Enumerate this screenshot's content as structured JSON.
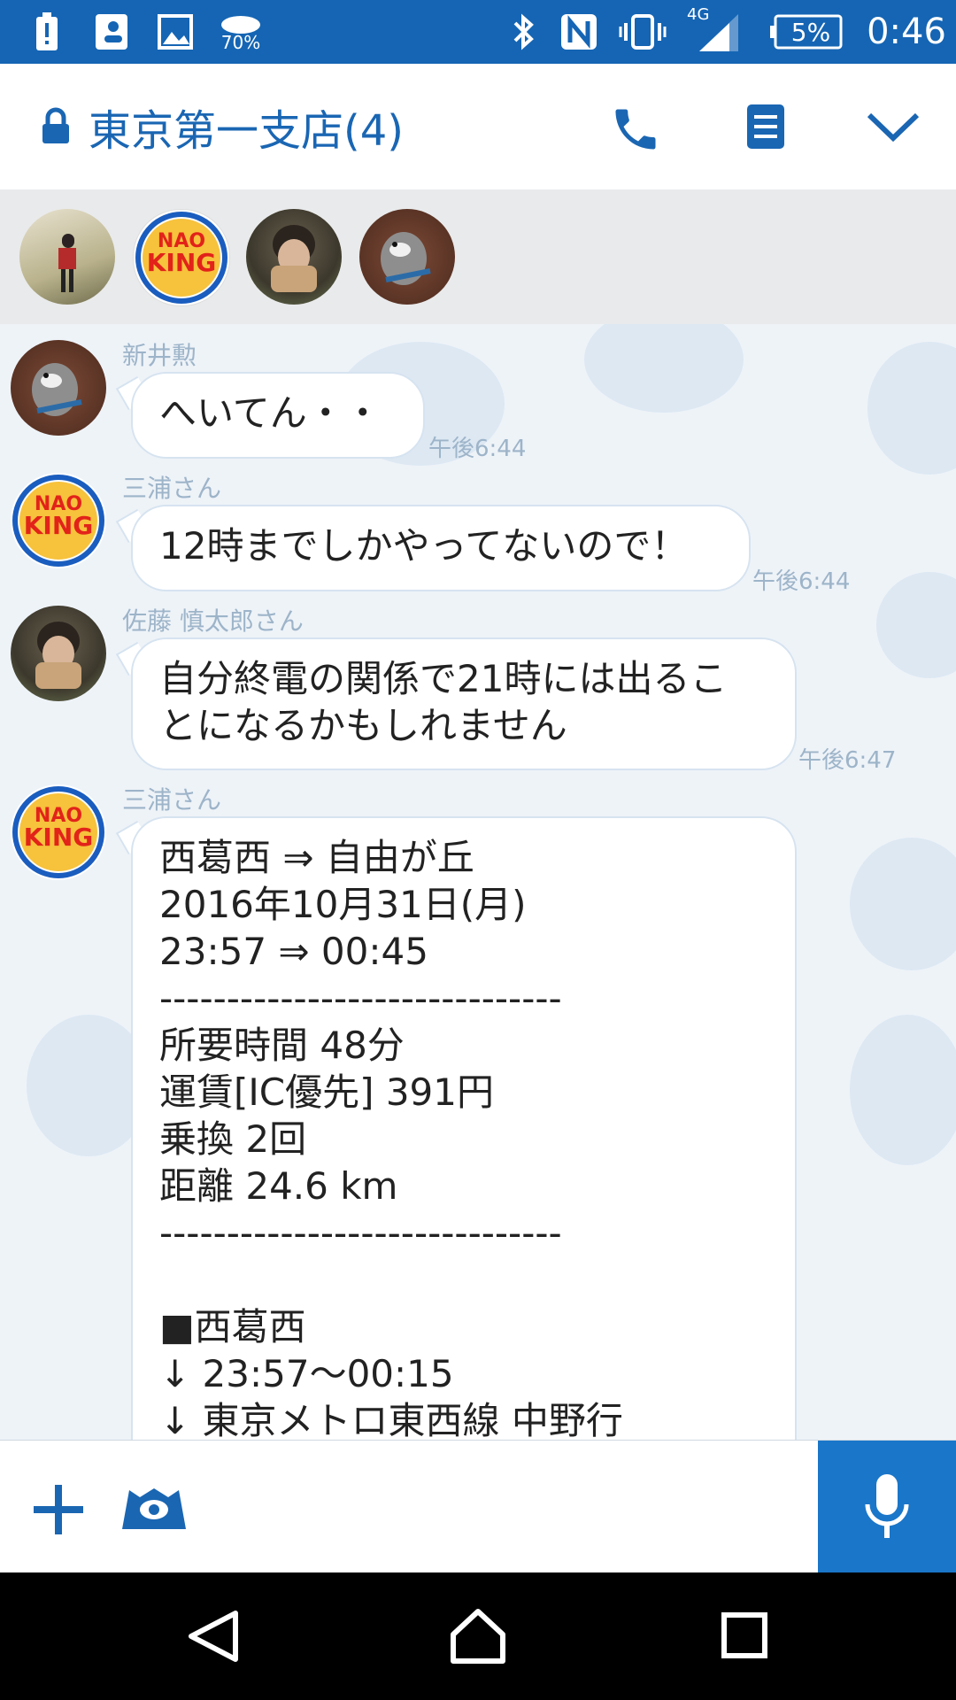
{
  "status_bar": {
    "battery_alert_icon": "battery-alert-icon",
    "weather_percent": "70%",
    "battery_percent": "5%",
    "time": "0:46",
    "network_label": "4G"
  },
  "header": {
    "title": "東京第一支店(4)"
  },
  "members": [
    "member-1",
    "member-2",
    "member-3",
    "member-4"
  ],
  "messages": [
    {
      "sender": "新井勲",
      "text": "へいてん・・",
      "time": "午後6:44"
    },
    {
      "sender": "三浦さん",
      "text": "12時までしかやってないので！",
      "time": "午後6:44"
    },
    {
      "sender": "佐藤 慎太郎さん",
      "text": "自分終電の関係で21時には出るこ\nとになるかもしれません",
      "time": "午後6:47"
    },
    {
      "sender": "三浦さん",
      "text": "西葛西 ⇒ 自由が丘\n2016年10月31日(月)\n23:57 ⇒ 00:45\n------------------------------\n所要時間 48分\n運賃[IC優先] 391円\n乗換 2回\n距離 24.6 km\n------------------------------\n\n■西葛西\n↓ 23:57～00:15\n↓ 東京メトロ東西線 中野行"
    }
  ],
  "avatar_logo": {
    "line1": "NAO",
    "line2": "KING"
  },
  "colors": {
    "status_bar": "#1565b4",
    "accent": "#1a66b3",
    "mic_button": "#1a76c9",
    "timestamp": "#9db4c9"
  }
}
